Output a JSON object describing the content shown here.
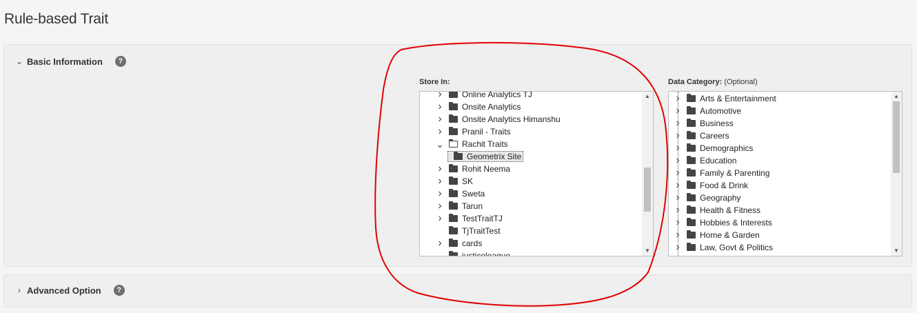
{
  "page": {
    "title": "Rule-based Trait"
  },
  "basic": {
    "label": "Basic Information",
    "help": "?",
    "store_label": "Store In:",
    "category_label_bold": "Data Category:",
    "category_label_rest": " (Optional)",
    "store_items": [
      {
        "label": "Online Analytics TJ",
        "arrow": ">",
        "depth": 0
      },
      {
        "label": "Onsite Analytics",
        "arrow": ">",
        "depth": 0
      },
      {
        "label": "Onsite Analytics Himanshu",
        "arrow": ">",
        "depth": 0
      },
      {
        "label": "Pranil - Traits",
        "arrow": ">",
        "depth": 0
      },
      {
        "label": "Rachit Traits",
        "arrow": "v",
        "depth": 0,
        "open": true
      },
      {
        "label": "Geometrix Site",
        "arrow": "",
        "depth": 1,
        "selected": true
      },
      {
        "label": "Rohit Neema",
        "arrow": ">",
        "depth": 0
      },
      {
        "label": "SK",
        "arrow": ">",
        "depth": 0
      },
      {
        "label": "Sweta",
        "arrow": ">",
        "depth": 0
      },
      {
        "label": "Tarun",
        "arrow": ">",
        "depth": 0
      },
      {
        "label": "TestTraitTJ",
        "arrow": ">",
        "depth": 0
      },
      {
        "label": "TjTraitTest",
        "arrow": "",
        "depth": 0
      },
      {
        "label": "cards",
        "arrow": ">",
        "depth": 0
      },
      {
        "label": "justiceleague",
        "arrow": "",
        "depth": 0
      }
    ],
    "category_items": [
      "Arts & Entertainment",
      "Automotive",
      "Business",
      "Careers",
      "Demographics",
      "Education",
      "Family & Parenting",
      "Food & Drink",
      "Geography",
      "Health & Fitness",
      "Hobbies & Interests",
      "Home & Garden",
      "Law, Govt & Politics"
    ],
    "store_scroll": 0.65,
    "category_scroll": 0.0
  },
  "advanced": {
    "label": "Advanced Option",
    "help": "?"
  },
  "colors": {
    "annotation": "#e00000",
    "panel": "#efefef",
    "page": "#f5f5f5"
  },
  "icons": {
    "expanded": "chevron-down-icon",
    "collapsed": "chevron-right-icon",
    "folder": "folder-icon",
    "help": "help-icon"
  }
}
